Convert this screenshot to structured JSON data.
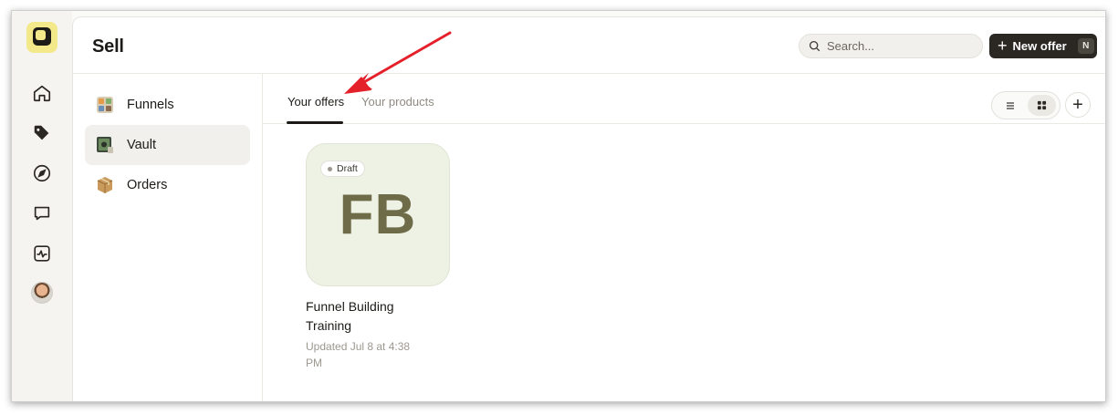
{
  "app": {
    "page_title": "Sell"
  },
  "search": {
    "placeholder": "Search..."
  },
  "new_offer": {
    "label": "New offer",
    "shortcut": "N"
  },
  "rail": {
    "items": [
      "home-icon",
      "tag-icon",
      "compass-icon",
      "chat-bubble-icon",
      "activity-icon"
    ]
  },
  "sidebar": {
    "items": [
      {
        "label": "Funnels",
        "icon": "funnels-icon"
      },
      {
        "label": "Vault",
        "icon": "vault-icon",
        "active": true
      },
      {
        "label": "Orders",
        "icon": "package-icon"
      }
    ]
  },
  "tabs": [
    {
      "label": "Your offers",
      "active": true
    },
    {
      "label": "Your products",
      "active": false
    }
  ],
  "view_toggle": [
    "list-view-icon",
    "grid-view-icon"
  ],
  "offers": [
    {
      "initials": "FB",
      "status": "Draft",
      "title": "Funnel Building Training",
      "updated": "Updated Jul 8 at 4:38 PM"
    }
  ],
  "colors": {
    "accent_dark": "#2b2824",
    "logo_yellow": "#f3e98a",
    "thumb_bg": "#eef2e4",
    "annotation_arrow": "#e4202a"
  }
}
